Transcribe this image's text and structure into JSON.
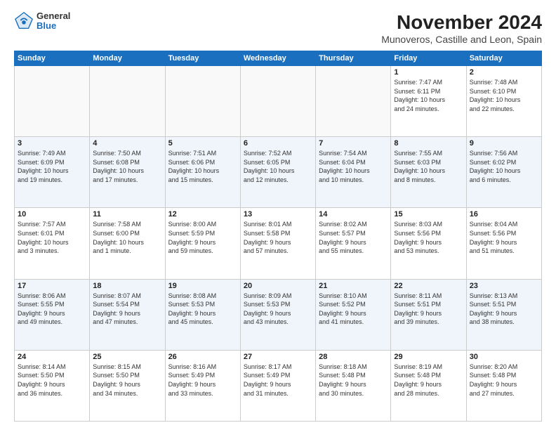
{
  "logo": {
    "general": "General",
    "blue": "Blue"
  },
  "title": "November 2024",
  "subtitle": "Munoveros, Castille and Leon, Spain",
  "headers": [
    "Sunday",
    "Monday",
    "Tuesday",
    "Wednesday",
    "Thursday",
    "Friday",
    "Saturday"
  ],
  "weeks": [
    [
      {
        "day": "",
        "info": ""
      },
      {
        "day": "",
        "info": ""
      },
      {
        "day": "",
        "info": ""
      },
      {
        "day": "",
        "info": ""
      },
      {
        "day": "",
        "info": ""
      },
      {
        "day": "1",
        "info": "Sunrise: 7:47 AM\nSunset: 6:11 PM\nDaylight: 10 hours\nand 24 minutes."
      },
      {
        "day": "2",
        "info": "Sunrise: 7:48 AM\nSunset: 6:10 PM\nDaylight: 10 hours\nand 22 minutes."
      }
    ],
    [
      {
        "day": "3",
        "info": "Sunrise: 7:49 AM\nSunset: 6:09 PM\nDaylight: 10 hours\nand 19 minutes."
      },
      {
        "day": "4",
        "info": "Sunrise: 7:50 AM\nSunset: 6:08 PM\nDaylight: 10 hours\nand 17 minutes."
      },
      {
        "day": "5",
        "info": "Sunrise: 7:51 AM\nSunset: 6:06 PM\nDaylight: 10 hours\nand 15 minutes."
      },
      {
        "day": "6",
        "info": "Sunrise: 7:52 AM\nSunset: 6:05 PM\nDaylight: 10 hours\nand 12 minutes."
      },
      {
        "day": "7",
        "info": "Sunrise: 7:54 AM\nSunset: 6:04 PM\nDaylight: 10 hours\nand 10 minutes."
      },
      {
        "day": "8",
        "info": "Sunrise: 7:55 AM\nSunset: 6:03 PM\nDaylight: 10 hours\nand 8 minutes."
      },
      {
        "day": "9",
        "info": "Sunrise: 7:56 AM\nSunset: 6:02 PM\nDaylight: 10 hours\nand 6 minutes."
      }
    ],
    [
      {
        "day": "10",
        "info": "Sunrise: 7:57 AM\nSunset: 6:01 PM\nDaylight: 10 hours\nand 3 minutes."
      },
      {
        "day": "11",
        "info": "Sunrise: 7:58 AM\nSunset: 6:00 PM\nDaylight: 10 hours\nand 1 minute."
      },
      {
        "day": "12",
        "info": "Sunrise: 8:00 AM\nSunset: 5:59 PM\nDaylight: 9 hours\nand 59 minutes."
      },
      {
        "day": "13",
        "info": "Sunrise: 8:01 AM\nSunset: 5:58 PM\nDaylight: 9 hours\nand 57 minutes."
      },
      {
        "day": "14",
        "info": "Sunrise: 8:02 AM\nSunset: 5:57 PM\nDaylight: 9 hours\nand 55 minutes."
      },
      {
        "day": "15",
        "info": "Sunrise: 8:03 AM\nSunset: 5:56 PM\nDaylight: 9 hours\nand 53 minutes."
      },
      {
        "day": "16",
        "info": "Sunrise: 8:04 AM\nSunset: 5:56 PM\nDaylight: 9 hours\nand 51 minutes."
      }
    ],
    [
      {
        "day": "17",
        "info": "Sunrise: 8:06 AM\nSunset: 5:55 PM\nDaylight: 9 hours\nand 49 minutes."
      },
      {
        "day": "18",
        "info": "Sunrise: 8:07 AM\nSunset: 5:54 PM\nDaylight: 9 hours\nand 47 minutes."
      },
      {
        "day": "19",
        "info": "Sunrise: 8:08 AM\nSunset: 5:53 PM\nDaylight: 9 hours\nand 45 minutes."
      },
      {
        "day": "20",
        "info": "Sunrise: 8:09 AM\nSunset: 5:53 PM\nDaylight: 9 hours\nand 43 minutes."
      },
      {
        "day": "21",
        "info": "Sunrise: 8:10 AM\nSunset: 5:52 PM\nDaylight: 9 hours\nand 41 minutes."
      },
      {
        "day": "22",
        "info": "Sunrise: 8:11 AM\nSunset: 5:51 PM\nDaylight: 9 hours\nand 39 minutes."
      },
      {
        "day": "23",
        "info": "Sunrise: 8:13 AM\nSunset: 5:51 PM\nDaylight: 9 hours\nand 38 minutes."
      }
    ],
    [
      {
        "day": "24",
        "info": "Sunrise: 8:14 AM\nSunset: 5:50 PM\nDaylight: 9 hours\nand 36 minutes."
      },
      {
        "day": "25",
        "info": "Sunrise: 8:15 AM\nSunset: 5:50 PM\nDaylight: 9 hours\nand 34 minutes."
      },
      {
        "day": "26",
        "info": "Sunrise: 8:16 AM\nSunset: 5:49 PM\nDaylight: 9 hours\nand 33 minutes."
      },
      {
        "day": "27",
        "info": "Sunrise: 8:17 AM\nSunset: 5:49 PM\nDaylight: 9 hours\nand 31 minutes."
      },
      {
        "day": "28",
        "info": "Sunrise: 8:18 AM\nSunset: 5:48 PM\nDaylight: 9 hours\nand 30 minutes."
      },
      {
        "day": "29",
        "info": "Sunrise: 8:19 AM\nSunset: 5:48 PM\nDaylight: 9 hours\nand 28 minutes."
      },
      {
        "day": "30",
        "info": "Sunrise: 8:20 AM\nSunset: 5:48 PM\nDaylight: 9 hours\nand 27 minutes."
      }
    ]
  ]
}
